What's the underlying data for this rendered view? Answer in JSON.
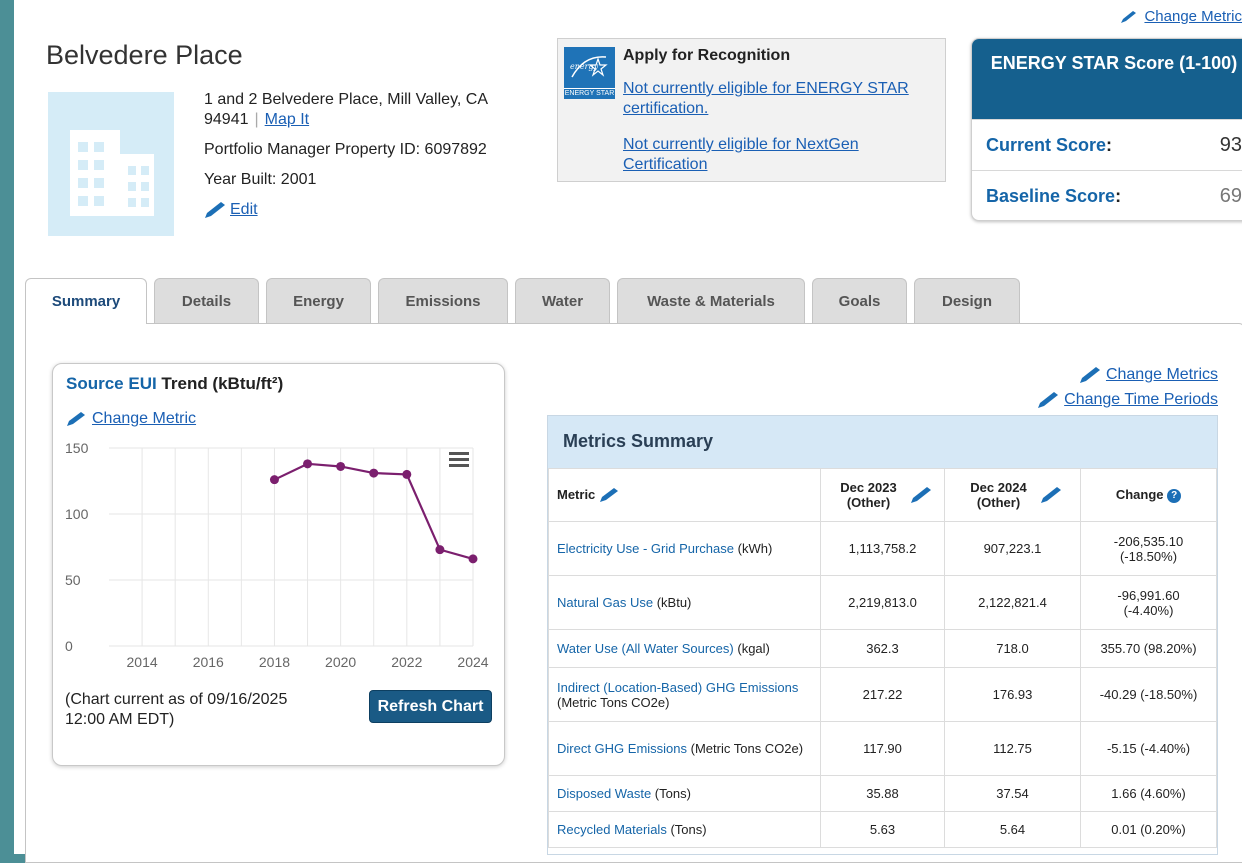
{
  "property": {
    "name": "Belvedere Place",
    "address_line1": "1 and 2 Belvedere Place, Mill Valley, CA",
    "address_zip": "94941",
    "map_link": "Map It",
    "property_id": "Portfolio Manager Property ID: 6097892",
    "year_built": "Year Built: 2001",
    "edit_label": "Edit"
  },
  "top_change_metric": "Change Metric",
  "recognition": {
    "logo_text": "ENERGY STAR",
    "title": "Apply for Recognition",
    "link1": "Not currently eligible for ENERGY STAR certification.",
    "link2": "Not currently eligible for NextGen Certification"
  },
  "score": {
    "title": "ENERGY STAR Score (1-100)",
    "current_label": "Current Score",
    "current_value": "93",
    "baseline_label": "Baseline Score",
    "baseline_value": "69"
  },
  "tabs": [
    {
      "label": "Summary"
    },
    {
      "label": "Details"
    },
    {
      "label": "Energy"
    },
    {
      "label": "Emissions"
    },
    {
      "label": "Water"
    },
    {
      "label": "Waste & Materials"
    },
    {
      "label": "Goals"
    },
    {
      "label": "Design"
    }
  ],
  "chart_card": {
    "title_blue": "Source EUI",
    "title_rest": " Trend (kBtu/ft²)",
    "change_metric": "Change Metric",
    "footnote": "(Chart current as of 09/16/2025 12:00 AM EDT)",
    "refresh_label": "Refresh Chart"
  },
  "chart_data": {
    "type": "line",
    "title": "Source EUI Trend (kBtu/ft²)",
    "x": [
      2018,
      2019,
      2020,
      2021,
      2022,
      2023,
      2024
    ],
    "values": [
      126,
      138,
      136,
      131,
      130,
      73,
      66
    ],
    "xlim": [
      2013,
      2024
    ],
    "ylim": [
      0,
      150
    ],
    "x_ticks": [
      2014,
      2016,
      2018,
      2020,
      2022,
      2024
    ],
    "y_ticks": [
      0,
      50,
      100,
      150
    ],
    "color": "#7b1f6e",
    "grid": true
  },
  "metrics_links": {
    "change_metrics": "Change Metrics",
    "change_time_periods": "Change Time Periods"
  },
  "metrics": {
    "title": "Metrics Summary",
    "columns": {
      "metric": "Metric",
      "period1": "Dec 2023 (Other)",
      "period2": "Dec 2024 (Other)",
      "change": "Change"
    },
    "rows": [
      {
        "name": "Electricity Use - Grid Purchase",
        "unit": " (kWh)",
        "v1": "1,113,758.2",
        "v2": "907,223.1",
        "change": "-206,535.10 (-18.50%)",
        "tone": "pos"
      },
      {
        "name": "Natural Gas Use",
        "unit": " (kBtu)",
        "v1": "2,219,813.0",
        "v2": "2,122,821.4",
        "change": "-96,991.60 (-4.40%)",
        "tone": "pos"
      },
      {
        "name": "Water Use (All Water Sources)",
        "unit": " (kgal)",
        "v1": "362.3",
        "v2": "718.0",
        "change": "355.70 (98.20%)",
        "tone": "neg"
      },
      {
        "name": "Indirect (Location-Based) GHG Emissions",
        "unit": " (Metric Tons CO2e)",
        "v1": "217.22",
        "v2": "176.93",
        "change": "-40.29 (-18.50%)",
        "tone": "pos"
      },
      {
        "name": "Direct GHG Emissions",
        "unit": " (Metric Tons CO2e)",
        "v1": "117.90",
        "v2": "112.75",
        "change": "-5.15 (-4.40%)",
        "tone": "pos"
      },
      {
        "name": "Disposed Waste",
        "unit": " (Tons)",
        "v1": "35.88",
        "v2": "37.54",
        "change": "1.66 (4.60%)",
        "tone": "neg"
      },
      {
        "name": "Recycled Materials",
        "unit": " (Tons)",
        "v1": "5.63",
        "v2": "5.64",
        "change": "0.01 (0.20%)",
        "tone": "neutral"
      }
    ]
  },
  "colors": {
    "page_bg": "#4c8f96",
    "score_header": "#15608e",
    "link": "#1565a8",
    "line": "#7b1f6e",
    "positive_change": "#2a8a2a",
    "negative_change": "#cc2222"
  }
}
